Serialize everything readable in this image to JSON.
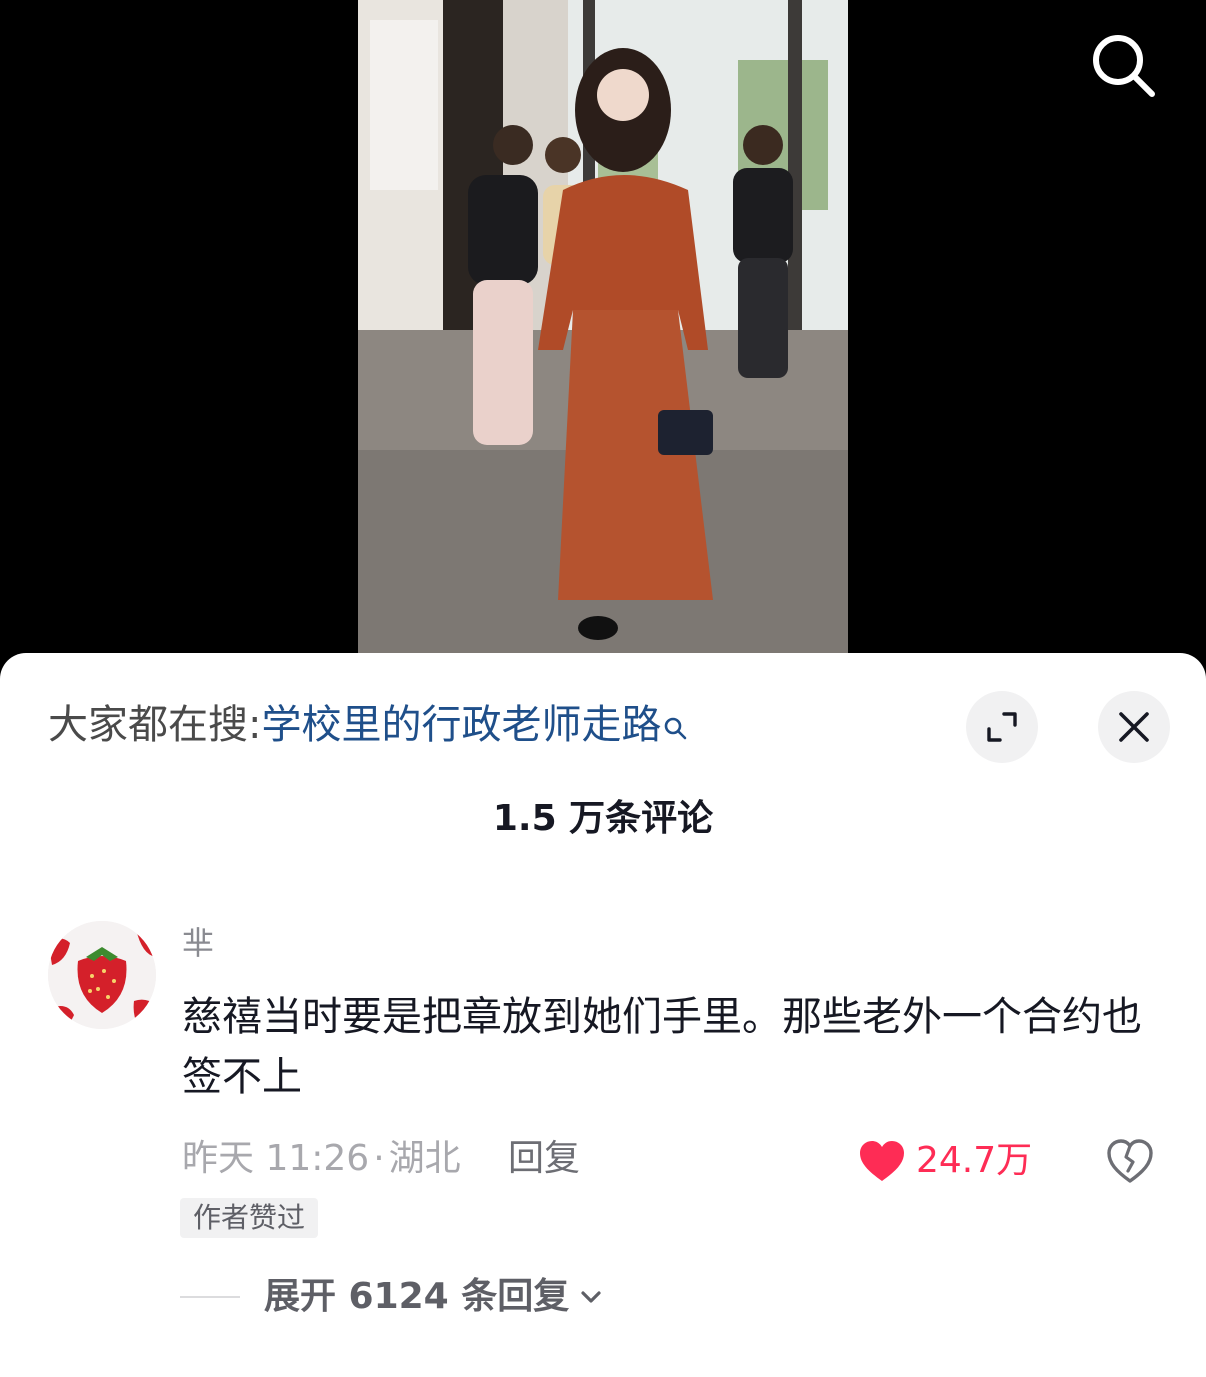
{
  "search_suggestion": {
    "label": "大家都在搜",
    "colon": ":",
    "query": "学校里的行政老师走路"
  },
  "comments_header": {
    "count_label": "1.5 万条评论"
  },
  "comment": {
    "username": "芈",
    "text": "慈禧当时要是把章放到她们手里。那些老外一个合约也签不上",
    "time": "昨天 11:26",
    "separator": "·",
    "location": "湖北",
    "reply_label": "回复",
    "like_count": "24.7万",
    "badge": "作者赞过",
    "expand_label": "展开 6124 条回复"
  },
  "colors": {
    "like_red": "#fe2c55",
    "query_blue": "#1f4f8a",
    "text_dark": "#161823",
    "text_gray": "#a8a8ad"
  },
  "icons": [
    "search-icon",
    "mini-search-icon",
    "expand-icon",
    "close-icon",
    "heart-icon",
    "broken-heart-icon",
    "chevron-down-icon"
  ]
}
